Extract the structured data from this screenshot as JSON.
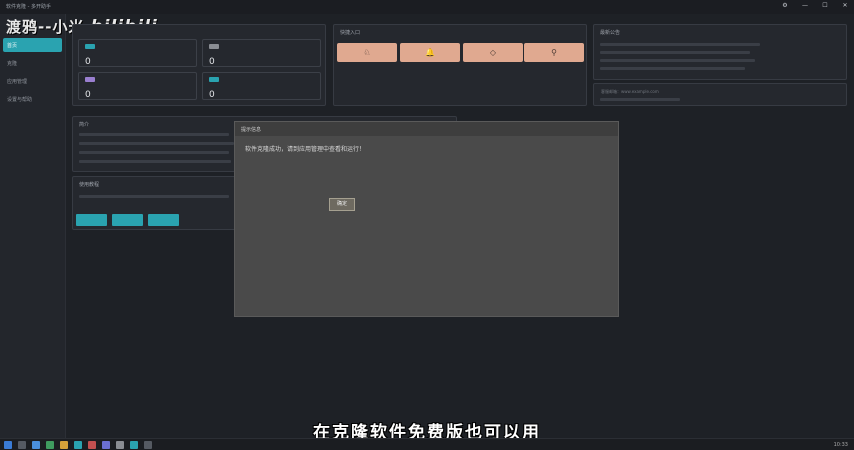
{
  "window": {
    "title": "软件克隆 - 多开助手",
    "controls": [
      "⚙",
      "—",
      "☐",
      "✕"
    ]
  },
  "watermark": {
    "text": "渡鸦--小米",
    "logo": "bilibili"
  },
  "sidebar": {
    "items": [
      {
        "label": "首页"
      },
      {
        "label": "克隆"
      },
      {
        "label": "应用管理"
      },
      {
        "label": "设置与帮助"
      }
    ]
  },
  "stats": [
    {
      "value": "0"
    },
    {
      "value": "0"
    },
    {
      "value": "0"
    },
    {
      "value": "0"
    }
  ],
  "quick": {
    "title": "快捷入口",
    "icons": [
      "♘",
      "🔔",
      "◇",
      "⚲"
    ]
  },
  "news": {
    "title": "最新公告",
    "contact": "客服邮箱：www.example.com"
  },
  "intro": {
    "title": "简介"
  },
  "tutorial": {
    "title": "使用教程"
  },
  "modal": {
    "title": "提示信息",
    "message": "软件克隆成功，请到应用管理中查看和运行！",
    "ok_label": "确定"
  },
  "subtitle": "在克隆软件免费版也可以用",
  "tray": {
    "time": "10:33"
  }
}
